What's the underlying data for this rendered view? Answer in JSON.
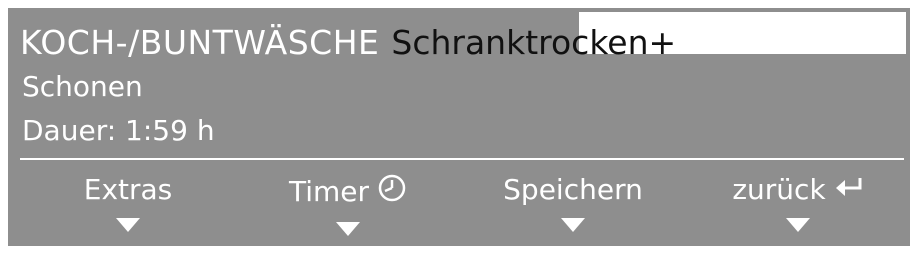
{
  "display": {
    "program": "KOCH-/BUNTWÄSCHE",
    "dry_level": "Schranktrocken+",
    "option": "Schonen",
    "duration": "Dauer: 1:59 h"
  },
  "softkeys": [
    {
      "label": "Extras"
    },
    {
      "label": "Timer",
      "icon": "clock-icon"
    },
    {
      "label": "Speichern"
    },
    {
      "label": "zurück",
      "icon": "back-arrow-icon"
    }
  ],
  "colors": {
    "screen_bg": "#8e8e8e",
    "text": "#ffffff",
    "highlight_bg": "#ffffff",
    "highlight_text": "#111111"
  }
}
